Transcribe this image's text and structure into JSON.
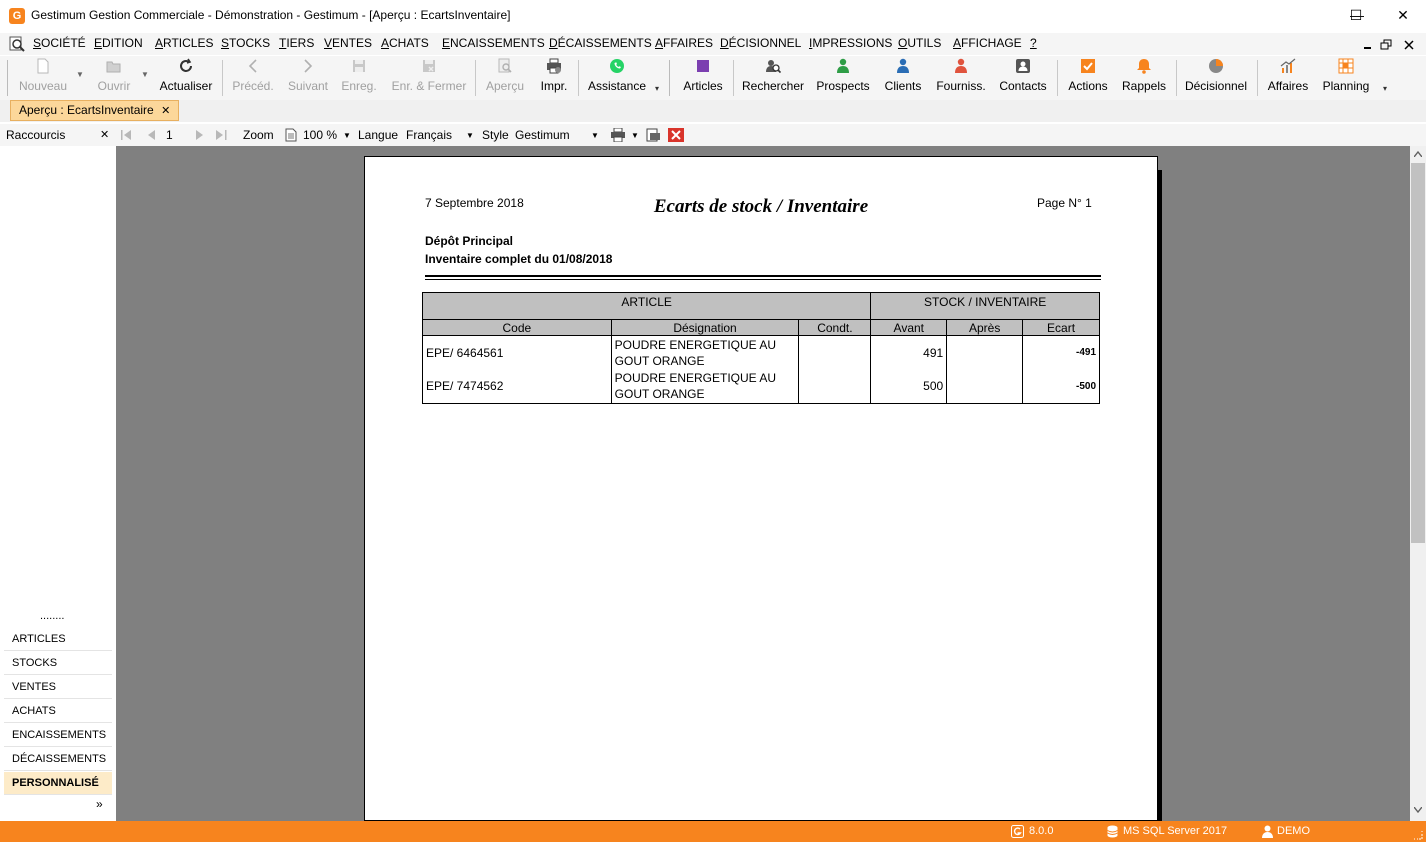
{
  "window": {
    "title": "Gestimum Gestion Commerciale - Démonstration - Gestimum - [Aperçu : EcartsInventaire]",
    "logo_letter": "G",
    "minimize": "—",
    "maximize": "☐",
    "close": "✕"
  },
  "menu": [
    "SOCIÉTÉ",
    "EDITION",
    "ARTICLES",
    "STOCKS",
    "TIERS",
    "VENTES",
    "ACHATS",
    "ENCAISSEMENTS",
    "DÉCAISSEMENTS",
    "AFFAIRES",
    "DÉCISIONNEL",
    "IMPRESSIONS",
    "OUTILS",
    "AFFICHAGE",
    "?"
  ],
  "toolbar": {
    "nouveau": "Nouveau",
    "ouvrir": "Ouvrir",
    "actualiser": "Actualiser",
    "preced": "Précéd.",
    "suivant": "Suivant",
    "enreg": "Enreg.",
    "enr_fermer": "Enr. & Fermer",
    "apercu": "Aperçu",
    "impr": "Impr.",
    "assistance": "Assistance",
    "articles": "Articles",
    "rechercher": "Rechercher",
    "prospects": "Prospects",
    "clients": "Clients",
    "fourniss": "Fourniss.",
    "contacts": "Contacts",
    "actions": "Actions",
    "rappels": "Rappels",
    "decisionnel": "Décisionnel",
    "affaires": "Affaires",
    "planning": "Planning"
  },
  "tab": {
    "label": "Aperçu : EcartsInventaire",
    "close": "✕"
  },
  "preview_toolbar": {
    "raccourcis": "Raccourcis",
    "page_number": "1",
    "zoom_label": "Zoom",
    "zoom_value": "100 %",
    "langue_label": "Langue",
    "langue_value": "Français",
    "style_label": "Style",
    "style_value": "Gestimum"
  },
  "sidebar": {
    "dots": "........",
    "items": [
      "ARTICLES",
      "STOCKS",
      "VENTES",
      "ACHATS",
      "ENCAISSEMENTS",
      "DÉCAISSEMENTS",
      "PERSONNALISÉ"
    ],
    "more": "»"
  },
  "report": {
    "date": "7 Septembre 2018",
    "title": "Ecarts de stock / Inventaire",
    "page": "Page N° 1",
    "depot": "Dépôt Principal",
    "inventaire": "Inventaire complet du 01/08/2018",
    "group_headers": [
      "ARTICLE",
      "STOCK / INVENTAIRE"
    ],
    "columns": [
      "Code",
      "Désignation",
      "Condt.",
      "Avant",
      "Après",
      "Ecart"
    ],
    "rows": [
      {
        "code": "EPE/ 6464561",
        "designation_1": "POUDRE ENERGETIQUE AU",
        "designation_2": "GOUT ORANGE",
        "condt": "",
        "avant": "491",
        "apres": "",
        "ecart": "-491"
      },
      {
        "code": "EPE/ 7474562",
        "designation_1": "POUDRE ENERGETIQUE AU",
        "designation_2": "GOUT ORANGE",
        "condt": "",
        "avant": "500",
        "apres": "",
        "ecart": "-500"
      }
    ]
  },
  "status": {
    "version": "8.0.0",
    "server": "MS SQL Server 2017",
    "user": "DEMO"
  },
  "colors": {
    "accent": "#f7841e",
    "tab_bg": "#fcd79a",
    "preview_bg": "#808080",
    "sidebar_active": "#fdebc8"
  }
}
